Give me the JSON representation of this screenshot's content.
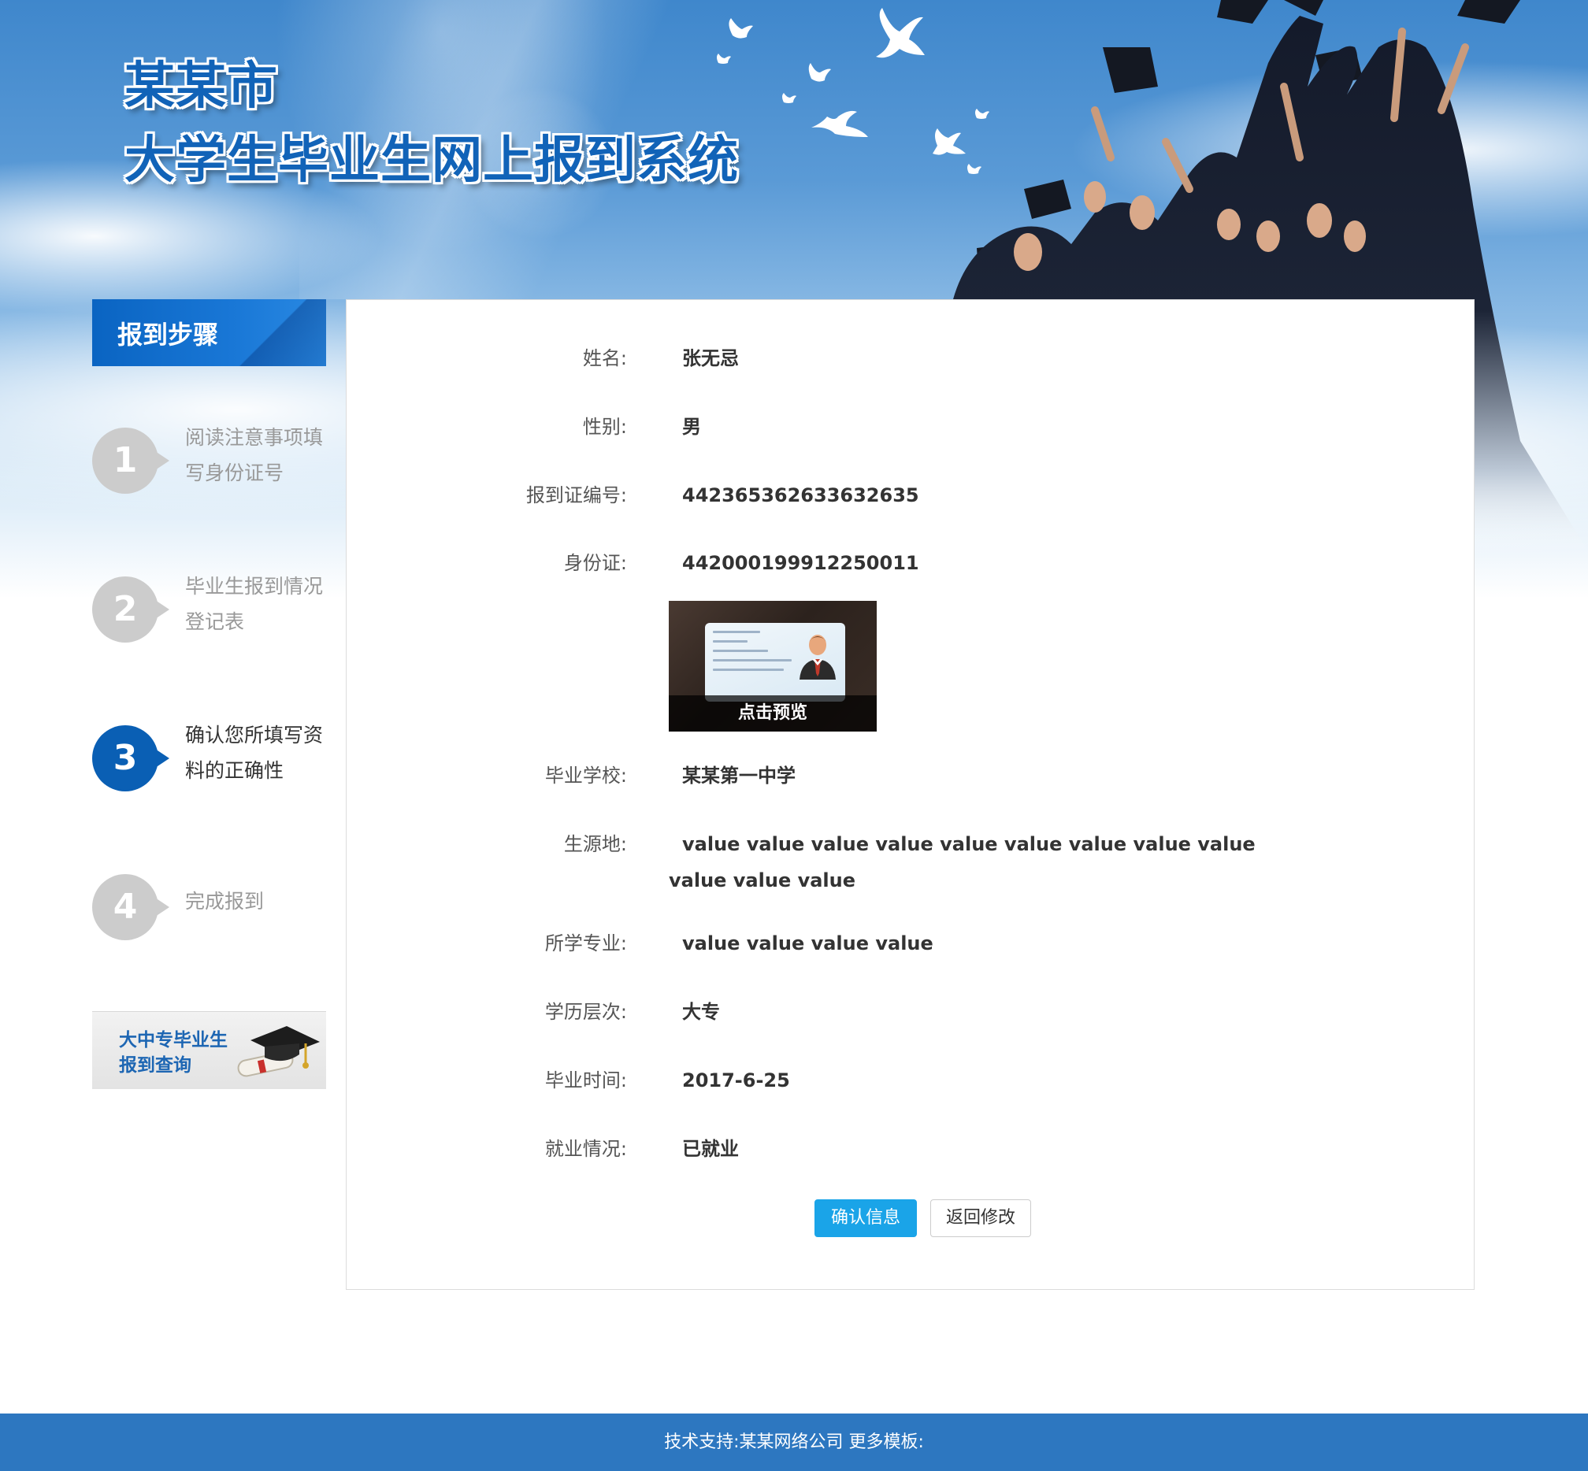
{
  "header": {
    "title_line1": "某某市",
    "title_line2": "大学生毕业生网上报到系统"
  },
  "sidebar": {
    "heading": "报到步骤",
    "steps": [
      {
        "number": "1",
        "text": "阅读注意事项填写身份证号",
        "active": false
      },
      {
        "number": "2",
        "text": "毕业生报到情况登记表",
        "active": false
      },
      {
        "number": "3",
        "text": "确认您所填写资料的正确性",
        "active": true
      },
      {
        "number": "4",
        "text": "完成报到",
        "active": false
      }
    ],
    "query_banner": {
      "line1": "大中专毕业生",
      "line2": "报到查询"
    }
  },
  "form": {
    "fields": [
      {
        "label": "姓名:",
        "value": "张无忌"
      },
      {
        "label": "性别:",
        "value": "男"
      },
      {
        "label": "报到证编号:",
        "value": "442365362633632635"
      },
      {
        "label": "身份证:",
        "value": "442000199912250011"
      },
      {
        "label": "毕业学校:",
        "value": "某某第一中学"
      },
      {
        "label": "生源地:",
        "value": "value value value value value value value value value value value value"
      },
      {
        "label": "所学专业:",
        "value": "value value value value"
      },
      {
        "label": "学历层次:",
        "value": "大专"
      },
      {
        "label": "毕业时间:",
        "value": "2017-6-25"
      },
      {
        "label": "就业情况:",
        "value": "已就业"
      }
    ],
    "id_preview_label": "点击预览",
    "confirm_button": "确认信息",
    "back_button": "返回修改"
  },
  "footer": {
    "text": "技术支持:某某网络公司 更多模板:"
  },
  "colors": {
    "brand_blue": "#1163b8",
    "step_active": "#0a5fb4",
    "step_inactive": "#cccccc",
    "button_primary": "#1aa4e8",
    "footer_bg": "#2d77c0"
  }
}
